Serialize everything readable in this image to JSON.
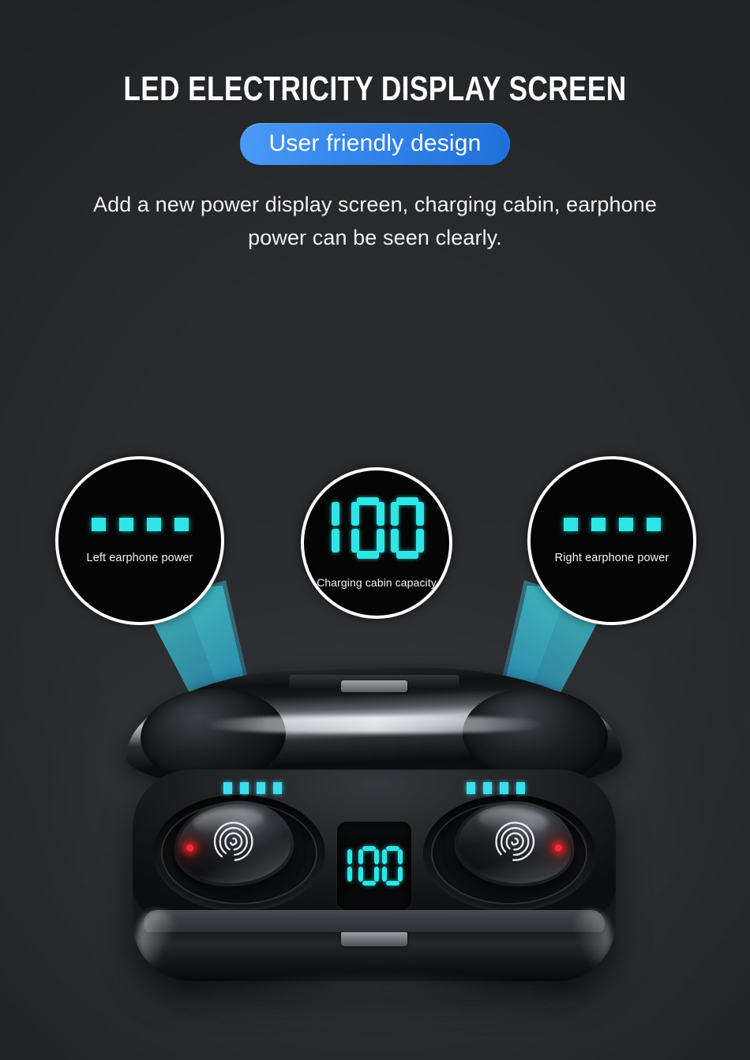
{
  "header": {
    "headline": "LED ELECTRICITY DISPLAY SCREEN",
    "badge": "User friendly design",
    "description_line1": "Add a new power display screen, charging cabin, earphone",
    "description_line2": "power can be seen clearly."
  },
  "watermark": "",
  "callouts": [
    {
      "id": "left-earphone",
      "label": "Left earphone power",
      "display_type": "segment-bars",
      "segments_total": 4,
      "segments_lit": 4
    },
    {
      "id": "charging-cabin",
      "label": "Charging cabin capacity",
      "display_type": "seven-segment",
      "value": "100"
    },
    {
      "id": "right-earphone",
      "label": "Right earphone power",
      "display_type": "segment-bars",
      "segments_total": 4,
      "segments_lit": 4
    }
  ],
  "product": {
    "name": "wireless-earbuds-charging-case",
    "case_display_value": "100",
    "left_case_leds_lit": 4,
    "right_case_leds_lit": 4,
    "left_bud_status_led": "red",
    "right_bud_status_led": "red",
    "bud_touch_icon": "fingerprint-icon"
  },
  "colors": {
    "background": "#2c2e32",
    "accent_blue": "#3688ee",
    "accent_blue_dark": "#1f6fd8",
    "led_cyan": "#2ee6e6",
    "case_led_cyan": "#3fdcee",
    "status_red": "#ff2a2a",
    "text_white": "#ffffff",
    "beam_teal": "#3fc4c9",
    "beam_blue": "#1b72c9"
  }
}
